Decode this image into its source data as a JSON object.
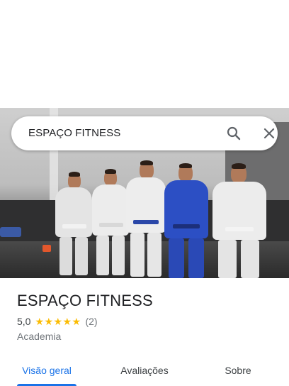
{
  "search": {
    "query": "ESPAÇO FITNESS",
    "search_icon": "search-icon",
    "close_icon": "close-icon"
  },
  "place": {
    "name": "ESPAÇO FITNESS",
    "rating": "5,0",
    "stars": 5,
    "review_count": "(2)",
    "category": "Academia"
  },
  "tabs": [
    {
      "label": "Visão geral",
      "active": true
    },
    {
      "label": "Avaliações",
      "active": false
    },
    {
      "label": "Sobre",
      "active": false
    }
  ],
  "colors": {
    "accent": "#1a73e8",
    "star": "#fbbc04",
    "secondary_text": "#70757a"
  }
}
